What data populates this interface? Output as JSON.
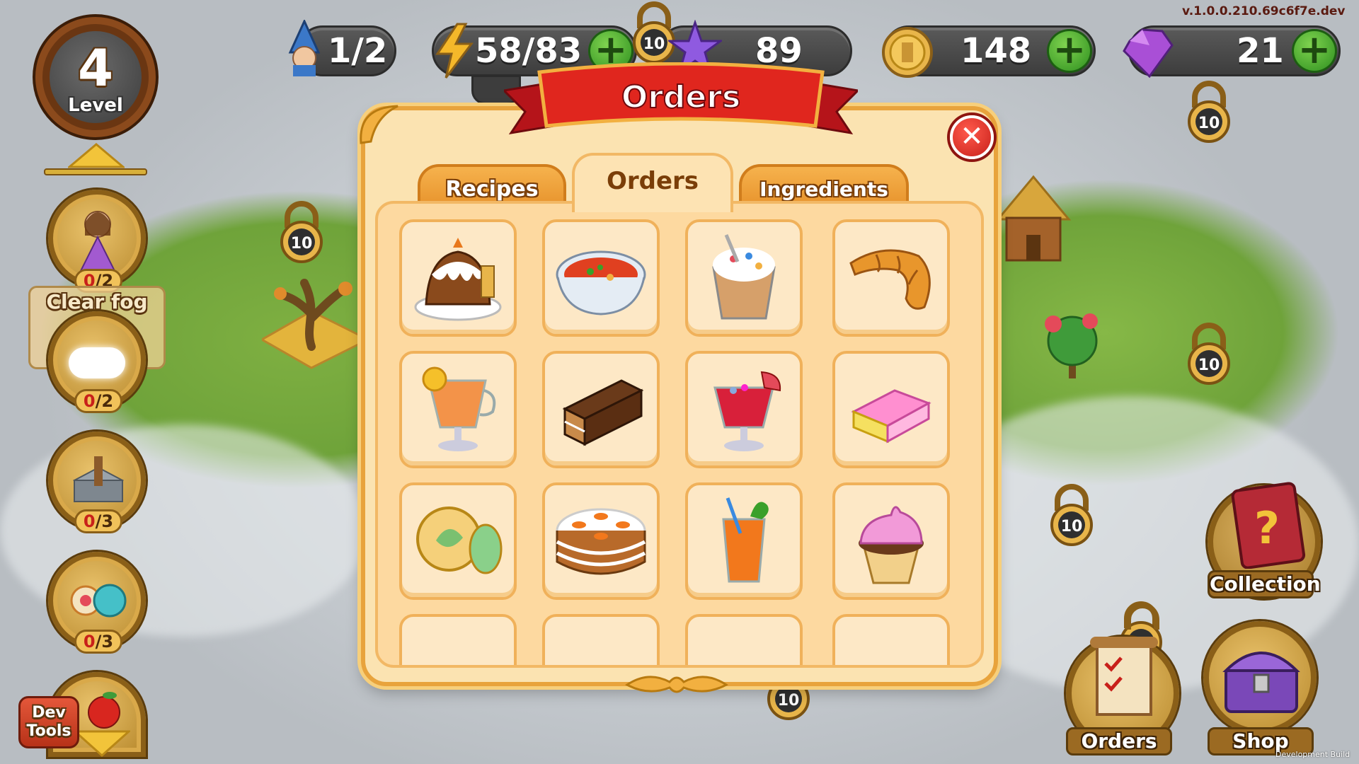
{
  "version": "v.1.0.0.210.69c6f7e.dev",
  "footer_note": "Development Build",
  "level": {
    "number": "4",
    "label": "Level"
  },
  "resources": {
    "workers": "1/2",
    "energy": "58/83",
    "stars": "89",
    "coins": "148",
    "gems": "21",
    "plus_label": "+",
    "star_lock_level": "10"
  },
  "side_buttons": [
    {
      "name": "princess",
      "current": "0",
      "total": "/2"
    },
    {
      "name": "clear-fog",
      "label": "Clear fog",
      "current": "0",
      "total": "/2"
    },
    {
      "name": "tower",
      "current": "0",
      "total": "/3"
    },
    {
      "name": "candy",
      "current": "0",
      "total": "/3"
    }
  ],
  "dev_tools": {
    "label_line1": "Dev",
    "label_line2": "Tools"
  },
  "map_locks": [
    "10",
    "10",
    "10",
    "10",
    "10",
    "10"
  ],
  "dialog": {
    "title": "Orders",
    "close_label": "✕",
    "tabs": [
      {
        "label": "Recipes",
        "active": false
      },
      {
        "label": "Orders",
        "active": true
      },
      {
        "label": "Ingredients",
        "active": false
      }
    ],
    "items": [
      {
        "name": "carrot-pudding-cake"
      },
      {
        "name": "tomato-soup"
      },
      {
        "name": "sprinkle-parfait"
      },
      {
        "name": "croissant"
      },
      {
        "name": "orange-tea-glass"
      },
      {
        "name": "chocolate-bar-cake"
      },
      {
        "name": "fruit-punch-glass"
      },
      {
        "name": "marshmallow-candy"
      },
      {
        "name": "leaf-cookies"
      },
      {
        "name": "carrot-cake"
      },
      {
        "name": "carrot-juice"
      },
      {
        "name": "pink-cupcake"
      }
    ]
  },
  "bottom_buttons": {
    "collection": "Collection",
    "orders": "Orders",
    "shop": "Shop",
    "collection_icon": "?"
  },
  "colors": {
    "accent_red": "#d82a1f",
    "plus_green": "#3aa02a",
    "panel": "#fde3b3"
  }
}
